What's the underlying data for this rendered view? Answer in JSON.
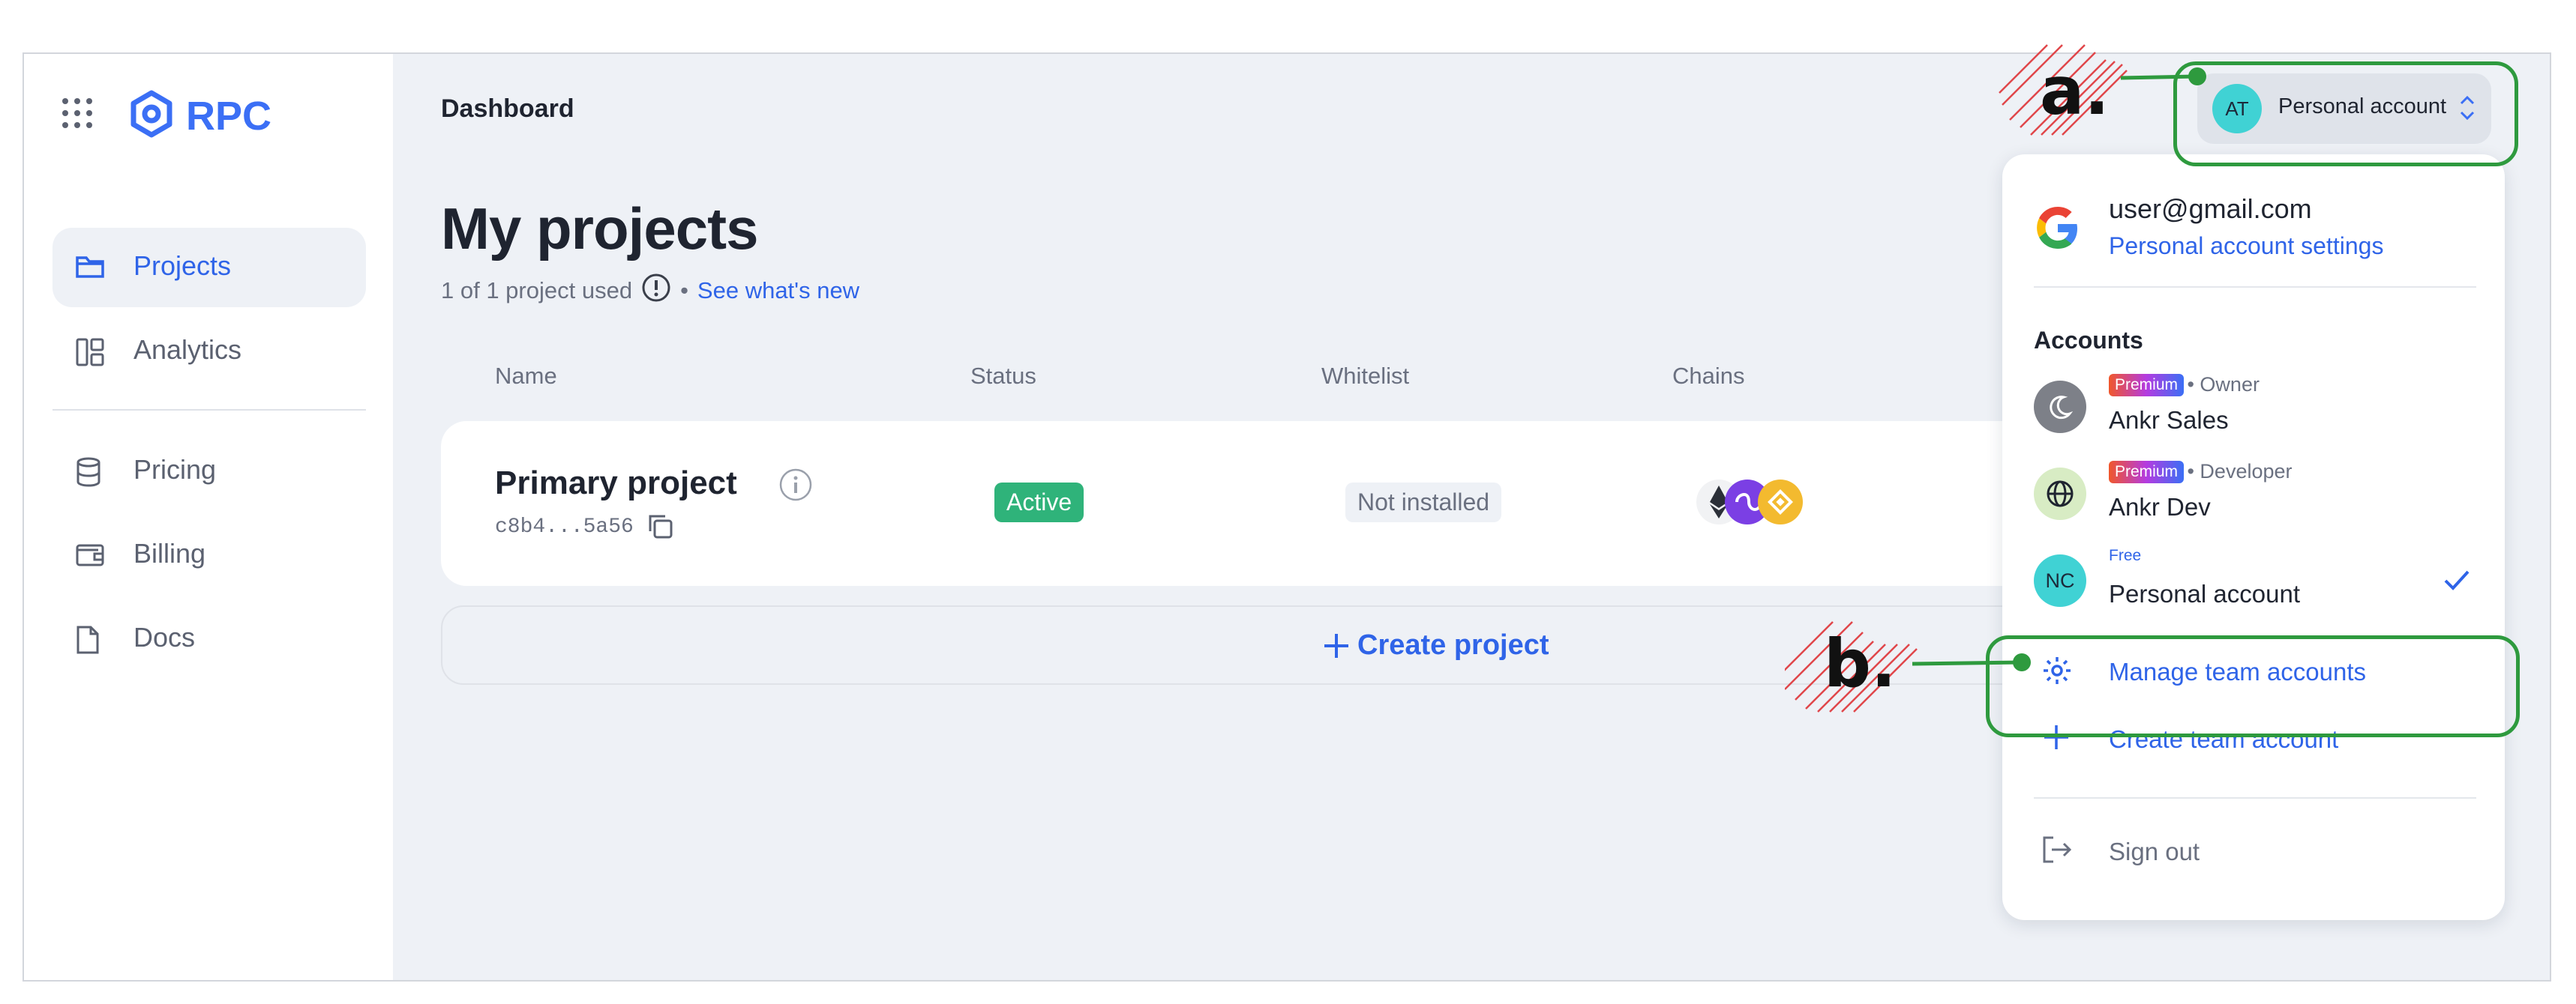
{
  "sidebar": {
    "brand": "RPC",
    "items": [
      {
        "label": "Projects",
        "icon": "folder-icon",
        "active": true
      },
      {
        "label": "Analytics",
        "icon": "analytics-icon",
        "active": false
      },
      {
        "label": "Pricing",
        "icon": "database-icon",
        "active": false
      },
      {
        "label": "Billing",
        "icon": "wallet-icon",
        "active": false
      },
      {
        "label": "Docs",
        "icon": "document-icon",
        "active": false
      }
    ]
  },
  "header": {
    "title": "Dashboard"
  },
  "main": {
    "heading": "My projects",
    "usage": "1 of 1 project used",
    "whats_new": "See what's new",
    "columns": [
      "Name",
      "Status",
      "Whitelist",
      "Chains"
    ],
    "project": {
      "name": "Primary project",
      "id": "c8b4...5a56",
      "status": "Active",
      "whitelist": "Not installed",
      "chains": [
        "ethereum-icon",
        "polygon-icon",
        "bnb-icon"
      ]
    },
    "create_project": "Create project"
  },
  "account_button": {
    "initials": "AT",
    "name": "Personal account"
  },
  "dropdown": {
    "email": "user@gmail.com",
    "settings": "Personal account settings",
    "accounts_title": "Accounts",
    "accounts": [
      {
        "plan": "Premium",
        "role": "• Owner",
        "name": "Ankr Sales",
        "avatar": "moon-icon",
        "avatar_color": "#7d8088"
      },
      {
        "plan": "Premium",
        "role": "• Developer",
        "name": "Ankr Dev",
        "avatar": "globe-icon",
        "avatar_color": "#d8ecc4"
      },
      {
        "plan": "Free",
        "role": "",
        "name": "Personal account",
        "avatar": "NC",
        "avatar_color": "#40d2d4",
        "selected": true
      }
    ],
    "manage": "Manage team accounts",
    "create_team": "Create team account",
    "sign_out": "Sign out"
  },
  "annotations": {
    "a": "a.",
    "b": "b."
  },
  "colors": {
    "accent": "#2f64e8",
    "success": "#2fb37a",
    "annotation": "#2e9a3e",
    "hatch": "#e0464a"
  }
}
